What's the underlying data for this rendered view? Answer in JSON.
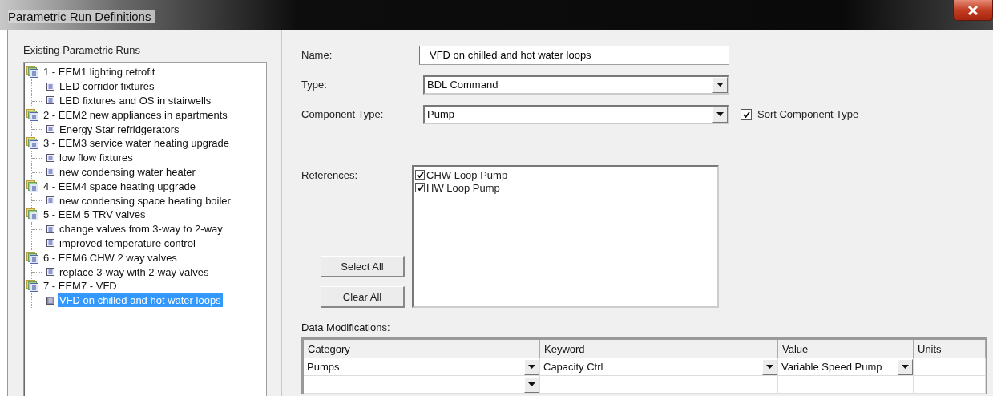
{
  "window": {
    "title": "Parametric Run Definitions"
  },
  "tree": {
    "label": "Existing Parametric Runs",
    "items": [
      {
        "label": "1 - EEM1 lighting retrofit",
        "selected": false,
        "children": [
          {
            "label": "LED corridor fixtures",
            "selected": false
          },
          {
            "label": "LED fixtures and OS in stairwells",
            "selected": false
          }
        ]
      },
      {
        "label": "2 - EEM2 new appliances in apartments",
        "selected": false,
        "children": [
          {
            "label": "Energy Star refridgerators",
            "selected": false
          }
        ]
      },
      {
        "label": "3 - EEM3 service water heating upgrade",
        "selected": false,
        "children": [
          {
            "label": "low flow fixtures",
            "selected": false
          },
          {
            "label": "new condensing water heater",
            "selected": false
          }
        ]
      },
      {
        "label": "4 - EEM4 space heating upgrade",
        "selected": false,
        "children": [
          {
            "label": "new condensing space heating boiler",
            "selected": false
          }
        ]
      },
      {
        "label": "5 - EEM 5 TRV valves",
        "selected": false,
        "children": [
          {
            "label": "change valves from 3-way to 2-way",
            "selected": false
          },
          {
            "label": "improved temperature control",
            "selected": false
          }
        ]
      },
      {
        "label": "6 - EEM6 CHW 2 way valves",
        "selected": false,
        "children": [
          {
            "label": "replace 3-way with 2-way valves",
            "selected": false
          }
        ]
      },
      {
        "label": "7 - EEM7 - VFD",
        "selected": false,
        "children": [
          {
            "label": "VFD on chilled and hot water loops",
            "selected": true
          }
        ]
      }
    ]
  },
  "form": {
    "name": {
      "label": "Name:",
      "value": "VFD on chilled and hot water loops"
    },
    "type": {
      "label": "Type:",
      "value": "BDL Command"
    },
    "component_type": {
      "label": "Component Type:",
      "value": "Pump"
    },
    "sort": {
      "label": "Sort Component Type",
      "checked": true
    },
    "references": {
      "label": "References:",
      "items": [
        {
          "label": "CHW Loop Pump",
          "checked": true
        },
        {
          "label": "HW Loop Pump",
          "checked": true
        }
      ]
    },
    "buttons": [
      "Select All",
      "Clear All"
    ]
  },
  "data_modifications": {
    "label": "Data Modifications:",
    "columns": [
      "Category",
      "Keyword",
      "Value",
      "Units"
    ],
    "rows": [
      [
        {
          "kind": "dropdown",
          "text": "Pumps"
        },
        {
          "kind": "dropdown",
          "text": "Capacity Ctrl"
        },
        {
          "kind": "dropdown",
          "text": "Variable Speed Pump"
        },
        {
          "kind": "text"
        }
      ],
      [
        {
          "kind": "dropdown"
        },
        {
          "kind": "text"
        },
        {
          "kind": "text"
        },
        {
          "kind": "text"
        }
      ]
    ]
  }
}
